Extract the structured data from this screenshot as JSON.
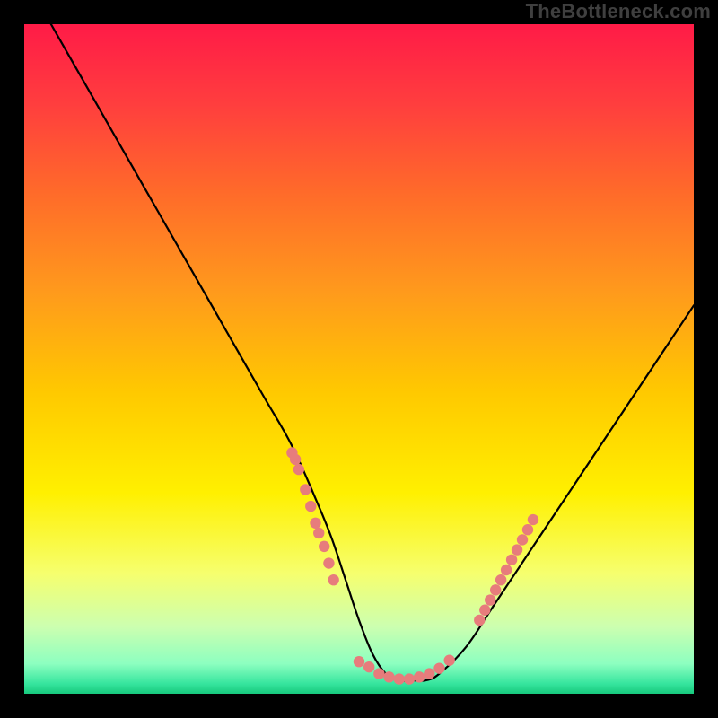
{
  "watermark": "TheBottleneck.com",
  "colors": {
    "background": "#000000",
    "curve": "#000000",
    "dot": "#e77c7c",
    "gradient_stops": [
      {
        "offset": 0.0,
        "color": "#ff1b47"
      },
      {
        "offset": 0.12,
        "color": "#ff3e3e"
      },
      {
        "offset": 0.25,
        "color": "#ff6a2a"
      },
      {
        "offset": 0.4,
        "color": "#ff9a1c"
      },
      {
        "offset": 0.55,
        "color": "#ffc900"
      },
      {
        "offset": 0.7,
        "color": "#fff000"
      },
      {
        "offset": 0.82,
        "color": "#f6ff6e"
      },
      {
        "offset": 0.9,
        "color": "#ccffb0"
      },
      {
        "offset": 0.955,
        "color": "#8dffc0"
      },
      {
        "offset": 0.985,
        "color": "#36e59e"
      },
      {
        "offset": 1.0,
        "color": "#17c97d"
      }
    ]
  },
  "chart_data": {
    "type": "line",
    "title": "",
    "xlabel": "",
    "ylabel": "",
    "xlim": [
      0,
      100
    ],
    "ylim": [
      0,
      100
    ],
    "legend": false,
    "grid": false,
    "series": [
      {
        "name": "curve",
        "x": [
          4,
          8,
          12,
          16,
          20,
          24,
          28,
          32,
          36,
          40,
          44,
          46,
          48,
          50,
          52,
          54,
          56,
          58,
          60,
          62,
          66,
          70,
          74,
          78,
          82,
          86,
          90,
          94,
          98,
          100
        ],
        "y": [
          100,
          93,
          86,
          79,
          72,
          65,
          58,
          51,
          44,
          37,
          28,
          23,
          17,
          11,
          6,
          3,
          2,
          2,
          2,
          3,
          7,
          13,
          19,
          25,
          31,
          37,
          43,
          49,
          55,
          58
        ]
      }
    ],
    "dot_clusters": [
      {
        "name": "left-arm-dots",
        "points": [
          [
            40,
            36
          ],
          [
            40.5,
            35
          ],
          [
            41,
            33.5
          ],
          [
            42,
            30.5
          ],
          [
            42.8,
            28
          ],
          [
            43.5,
            25.5
          ],
          [
            44,
            24
          ],
          [
            44.8,
            22
          ],
          [
            45.5,
            19.5
          ],
          [
            46.2,
            17
          ]
        ]
      },
      {
        "name": "valley-dots",
        "points": [
          [
            50,
            4.8
          ],
          [
            51.5,
            4
          ],
          [
            53,
            3
          ],
          [
            54.5,
            2.5
          ],
          [
            56,
            2.2
          ],
          [
            57.5,
            2.2
          ],
          [
            59,
            2.5
          ],
          [
            60.5,
            3
          ],
          [
            62,
            3.8
          ],
          [
            63.5,
            5
          ]
        ]
      },
      {
        "name": "right-arm-dots",
        "points": [
          [
            68,
            11
          ],
          [
            68.8,
            12.5
          ],
          [
            69.6,
            14
          ],
          [
            70.4,
            15.5
          ],
          [
            71.2,
            17
          ],
          [
            72,
            18.5
          ],
          [
            72.8,
            20
          ],
          [
            73.6,
            21.5
          ],
          [
            74.4,
            23
          ],
          [
            75.2,
            24.5
          ],
          [
            76,
            26
          ]
        ]
      }
    ]
  }
}
